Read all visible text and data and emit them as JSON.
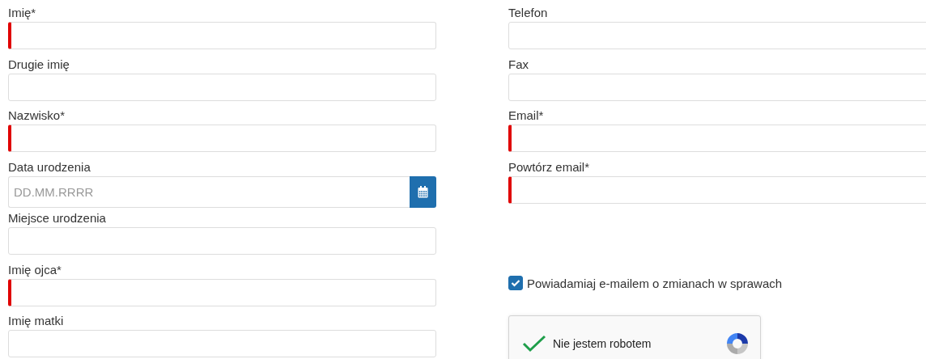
{
  "left_fields": [
    {
      "label": "Imię*",
      "kind": "text",
      "required": true
    },
    {
      "label": "Drugie imię",
      "kind": "text",
      "required": false
    },
    {
      "label": "Nazwisko*",
      "kind": "text",
      "required": true
    },
    {
      "label": "Data urodzenia",
      "kind": "date",
      "required": false,
      "placeholder": "DD.MM.RRRR"
    },
    {
      "label": "Miejsce urodzenia",
      "kind": "text",
      "required": false
    },
    {
      "label": "Imię ojca*",
      "kind": "text",
      "required": true
    },
    {
      "label": "Imię matki",
      "kind": "text",
      "required": false
    }
  ],
  "right_fields": [
    {
      "label": "Telefon",
      "kind": "text",
      "required": false
    },
    {
      "label": "Fax",
      "kind": "text",
      "required": false
    },
    {
      "label": "Email*",
      "kind": "text",
      "required": true
    },
    {
      "label": "Powtórz email*",
      "kind": "text",
      "required": true
    }
  ],
  "notify": {
    "label": "Powiadamiaj e-mailem o zmianach w sprawach",
    "checked": true
  },
  "captcha": {
    "label": "Nie jestem robotem",
    "checked": true
  }
}
